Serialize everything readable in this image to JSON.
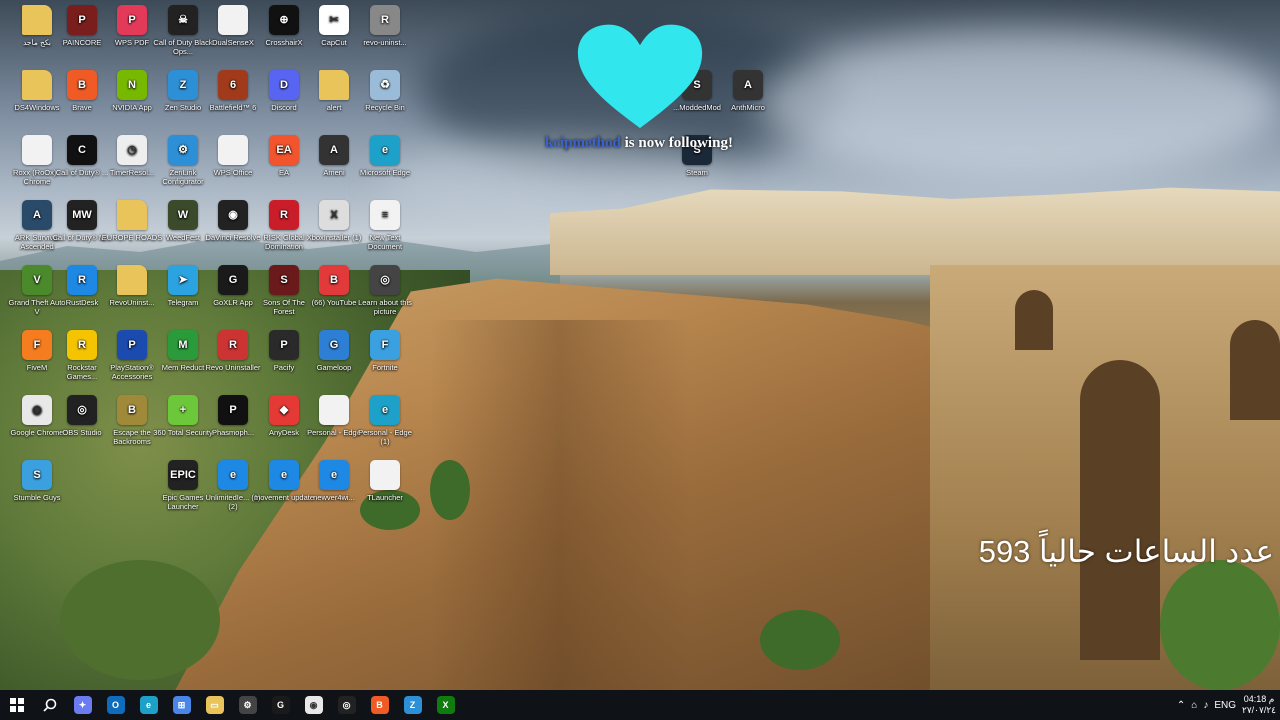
{
  "desktop_icons": [
    {
      "name": "Folder",
      "color": "#e9c45a",
      "glyph": "",
      "label": "بكج ماجد"
    },
    {
      "name": "PAINCORE",
      "color": "#7a1d1d",
      "glyph": "P",
      "label": "PAINCORE"
    },
    {
      "name": "WPS PDF",
      "color": "#e33a5a",
      "glyph": "P",
      "label": "WPS PDF"
    },
    {
      "name": "Call of Duty Black Ops",
      "color": "#222",
      "glyph": "☠",
      "label": "Call of Duty Black Ops..."
    },
    {
      "name": "DualSenseX",
      "color": "#f2f2f2",
      "glyph": "",
      "label": "DualSenseX"
    },
    {
      "name": "Crosshair X",
      "color": "#111",
      "glyph": "⊕",
      "label": "CrosshairX"
    },
    {
      "name": "CapCut",
      "color": "#fff",
      "glyph": "✂",
      "label": "CapCut"
    },
    {
      "name": "revo-uninstaller",
      "color": "#888",
      "glyph": "R",
      "label": "revo-uninst..."
    },
    {
      "name": "DS4Windows",
      "color": "#e9c45a",
      "glyph": "",
      "label": "DS4Windows"
    },
    {
      "name": "Brave",
      "color": "#f05a24",
      "glyph": "B",
      "label": "Brave"
    },
    {
      "name": "NVIDIA App",
      "color": "#76b900",
      "glyph": "N",
      "label": "NVIDIA App"
    },
    {
      "name": "Zen Studio",
      "color": "#2d8fd5",
      "glyph": "Z",
      "label": "Zen Studio"
    },
    {
      "name": "Battlefield 6",
      "color": "#a03a1a",
      "glyph": "6",
      "label": "Battlefield™ 6"
    },
    {
      "name": "Discord",
      "color": "#5865f2",
      "glyph": "D",
      "label": "Discord"
    },
    {
      "name": "alert",
      "color": "#e9c45a",
      "glyph": "",
      "label": "alert"
    },
    {
      "name": "Recycle Bin",
      "color": "#9bbcd8",
      "glyph": "♻",
      "label": "Recycle Bin"
    },
    {
      "name": "Roxx Chrome",
      "color": "#f2f2f2",
      "glyph": "",
      "label": "Roxx (RoOx) - Chrome"
    },
    {
      "name": "Call of Duty 2",
      "color": "#111",
      "glyph": "C",
      "label": "Call of Duty® ..."
    },
    {
      "name": "TimerResolution",
      "color": "#eee",
      "glyph": "◷",
      "label": "TimerResol..."
    },
    {
      "name": "ZenLink Configurator",
      "color": "#2d8fd5",
      "glyph": "⚙",
      "label": "ZenLink Configurator"
    },
    {
      "name": "WPS Office",
      "color": "#f2f2f2",
      "glyph": "",
      "label": "WPS Office"
    },
    {
      "name": "EA",
      "color": "#f2542d",
      "glyph": "EA",
      "label": "EA"
    },
    {
      "name": "Ameni",
      "color": "#333",
      "glyph": "A",
      "label": "Ameni"
    },
    {
      "name": "Microsoft Edge",
      "color": "#1da1c9",
      "glyph": "e",
      "label": "Microsoft Edge"
    },
    {
      "name": "ARK Survival Ascended",
      "color": "#2a4a6a",
      "glyph": "A",
      "label": "ARK Survival Ascended"
    },
    {
      "name": "Call of Duty MW",
      "color": "#222",
      "glyph": "MW",
      "label": "Call of Duty® M..."
    },
    {
      "name": "EUROPE ROADS",
      "color": "#e9c45a",
      "glyph": "",
      "label": "EUROPE ROADS"
    },
    {
      "name": "WeedFest",
      "color": "#3a4a2a",
      "glyph": "W",
      "label": "WeedFest"
    },
    {
      "name": "DaVinci Resolve",
      "color": "#222",
      "glyph": "◉",
      "label": "DaVinci Resolve"
    },
    {
      "name": "RISK Global Domination",
      "color": "#c91d2a",
      "glyph": "R",
      "label": "RISK Global Domination"
    },
    {
      "name": "Xboxinstaller",
      "color": "#ddd",
      "glyph": "X",
      "label": "XboxInstaller (1)"
    },
    {
      "name": "New Text Document",
      "color": "#f2f2f2",
      "glyph": "≡",
      "label": "New Text Document"
    },
    {
      "name": "Grand Theft Auto V",
      "color": "#4a8a2a",
      "glyph": "V",
      "label": "Grand Theft Auto V"
    },
    {
      "name": "RustDesk",
      "color": "#1e88e5",
      "glyph": "R",
      "label": "RustDesk"
    },
    {
      "name": "RevoUninstaller",
      "color": "#e9c45a",
      "glyph": "",
      "label": "RevoUninst..."
    },
    {
      "name": "Telegram",
      "color": "#2aa3e0",
      "glyph": "➤",
      "label": "Telegram"
    },
    {
      "name": "GoXLR App",
      "color": "#1a1a1a",
      "glyph": "G",
      "label": "GoXLR App"
    },
    {
      "name": "Sons Of The Forest",
      "color": "#6a1a1a",
      "glyph": "S",
      "label": "Sons Of The Forest"
    },
    {
      "name": "YouTube",
      "color": "#e23a3a",
      "glyph": "B",
      "label": "(66) YouTube"
    },
    {
      "name": "Learn about this picture",
      "color": "#444",
      "glyph": "◎",
      "label": "Learn about this picture"
    },
    {
      "name": "FiveM",
      "color": "#f57c1f",
      "glyph": "F",
      "label": "FiveM"
    },
    {
      "name": "Rockstar Games Launcher",
      "color": "#f5c400",
      "glyph": "R",
      "label": "Rockstar Games..."
    },
    {
      "name": "PlayStation Accessories",
      "color": "#1c4bb0",
      "glyph": "P",
      "label": "PlayStation® Accessories"
    },
    {
      "name": "Mem Reduct",
      "color": "#2a9a3a",
      "glyph": "M",
      "label": "Mem Reduct"
    },
    {
      "name": "Revo Uninstaller",
      "color": "#c33",
      "glyph": "R",
      "label": "Revo Uninstaller"
    },
    {
      "name": "Pacify",
      "color": "#2a2a2a",
      "glyph": "P",
      "label": "Pacify"
    },
    {
      "name": "Gameloop",
      "color": "#2d7fd5",
      "glyph": "G",
      "label": "Gameloop"
    },
    {
      "name": "Fortnite",
      "color": "#3aa0e0",
      "glyph": "F",
      "label": "Fortnite"
    },
    {
      "name": "Google Chrome",
      "color": "#e8e8e8",
      "glyph": "◉",
      "label": "Google Chrome"
    },
    {
      "name": "OBS Studio",
      "color": "#222",
      "glyph": "◎",
      "label": "OBS Studio"
    },
    {
      "name": "Escape the Backrooms",
      "color": "#a08a3a",
      "glyph": "B",
      "label": "Escape the Backrooms"
    },
    {
      "name": "360 Total Security",
      "color": "#6cc83a",
      "glyph": "+",
      "label": "360 Total Security"
    },
    {
      "name": "Phasmophobia",
      "color": "#111",
      "glyph": "P",
      "label": "Phasmoph..."
    },
    {
      "name": "AnyDesk",
      "color": "#e53935",
      "glyph": "◆",
      "label": "AnyDesk"
    },
    {
      "name": "Personal Edge",
      "color": "#f2f2f2",
      "glyph": "",
      "label": "Personal - Edge"
    },
    {
      "name": "Personal Edge 1",
      "color": "#1da1c9",
      "glyph": "e",
      "label": "Personal - Edge (1)"
    },
    {
      "name": "Stumble Guys",
      "color": "#3aa0e0",
      "glyph": "S",
      "label": "Stumble Guys"
    },
    {
      "name": "Epic Games Launcher",
      "color": "#222",
      "glyph": "EPIC",
      "label": "Epic Games Launcher"
    },
    {
      "name": "UnlimitedIE",
      "color": "#1e88e5",
      "glyph": "e",
      "label": "UnlimitedIe... (1) (2)"
    },
    {
      "name": "movement update",
      "color": "#1e88e5",
      "glyph": "e",
      "label": "movement update"
    },
    {
      "name": "newver4wi",
      "color": "#1e88e5",
      "glyph": "e",
      "label": "newver4wi..."
    },
    {
      "name": "TLauncher",
      "color": "#f2f2f2",
      "glyph": "",
      "label": "TLauncher"
    },
    {
      "name": "SteamModded",
      "color": "#333",
      "glyph": "S",
      "label": "...ModdedMod"
    },
    {
      "name": "AnthMicro",
      "color": "#333",
      "glyph": "A",
      "label": "AnthMicro"
    },
    {
      "name": "Steam",
      "color": "#1b2838",
      "glyph": "S",
      "label": "Steam"
    }
  ],
  "notification": {
    "username": "kcipmethod",
    "message": " is now following!"
  },
  "overlay_text": "عدد الساعات حالياً 593",
  "taskbar": {
    "apps": [
      {
        "name": "copilot",
        "glyph": "✦",
        "color": "#6b7cf0"
      },
      {
        "name": "outlook",
        "glyph": "O",
        "color": "#0f6cbd"
      },
      {
        "name": "edge",
        "glyph": "e",
        "color": "#1da1c9"
      },
      {
        "name": "store",
        "glyph": "⊞",
        "color": "#4a86e8"
      },
      {
        "name": "file-explorer",
        "glyph": "▭",
        "color": "#e9c45a"
      },
      {
        "name": "settings",
        "glyph": "⚙",
        "color": "#444"
      },
      {
        "name": "goxlr",
        "glyph": "G",
        "color": "#1a1a1a"
      },
      {
        "name": "chrome",
        "glyph": "◉",
        "color": "#e8e8e8"
      },
      {
        "name": "obs",
        "glyph": "◎",
        "color": "#222"
      },
      {
        "name": "brave",
        "glyph": "B",
        "color": "#f05a24"
      },
      {
        "name": "zen-studio",
        "glyph": "Z",
        "color": "#2d8fd5"
      },
      {
        "name": "xbox",
        "glyph": "X",
        "color": "#107c10"
      }
    ],
    "language": "ENG",
    "time": "04:18 م",
    "date": "٢٧/٠٧/٢٤"
  }
}
